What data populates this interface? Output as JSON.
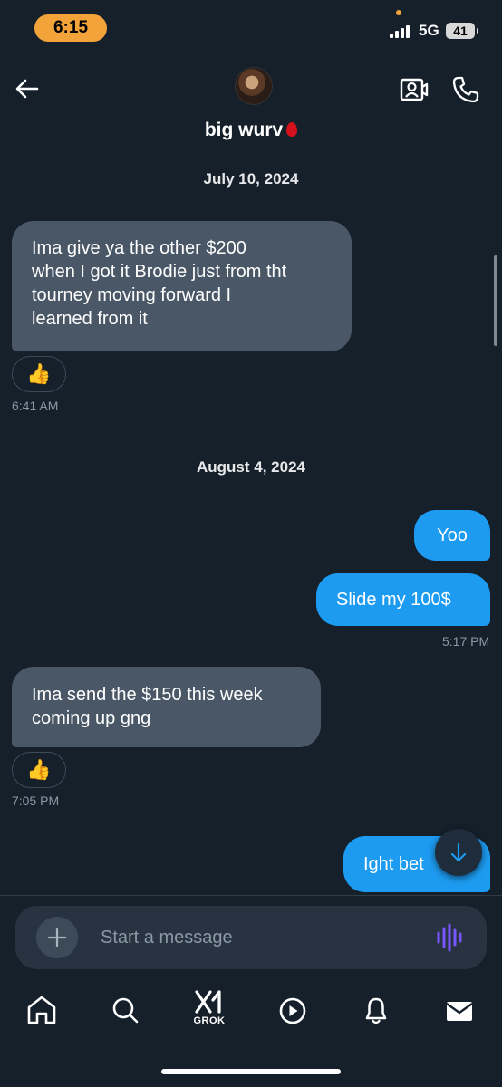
{
  "status_bar": {
    "time": "6:15",
    "network": "5G",
    "battery": "41"
  },
  "header": {
    "contact_name": "big wurv"
  },
  "conversation": {
    "date_1": "July 10, 2024",
    "msg_1": [
      "Ima give ya the other $200",
      "when I got it Brodie just from tht",
      "tourney moving forward I",
      "learned from it"
    ],
    "msg_1_reaction": "👍",
    "msg_1_time": "6:41 AM",
    "date_2": "August 4, 2024",
    "msg_2": "Yoo",
    "msg_3": "Slide my 100$",
    "msg_3_time": "5:17 PM",
    "msg_4": [
      "Ima send the $150 this week",
      "coming up gng"
    ],
    "msg_4_reaction": "👍",
    "msg_4_time": "7:05 PM",
    "msg_5": "Ight bet"
  },
  "composer": {
    "placeholder": "Start a message"
  },
  "tab_bar": {
    "grok_label": "GROK"
  },
  "colors": {
    "background": "#15202b",
    "incoming_bubble": "#495766",
    "outgoing_bubble": "#1d9bf0",
    "accent_voice": "#7856ff"
  }
}
